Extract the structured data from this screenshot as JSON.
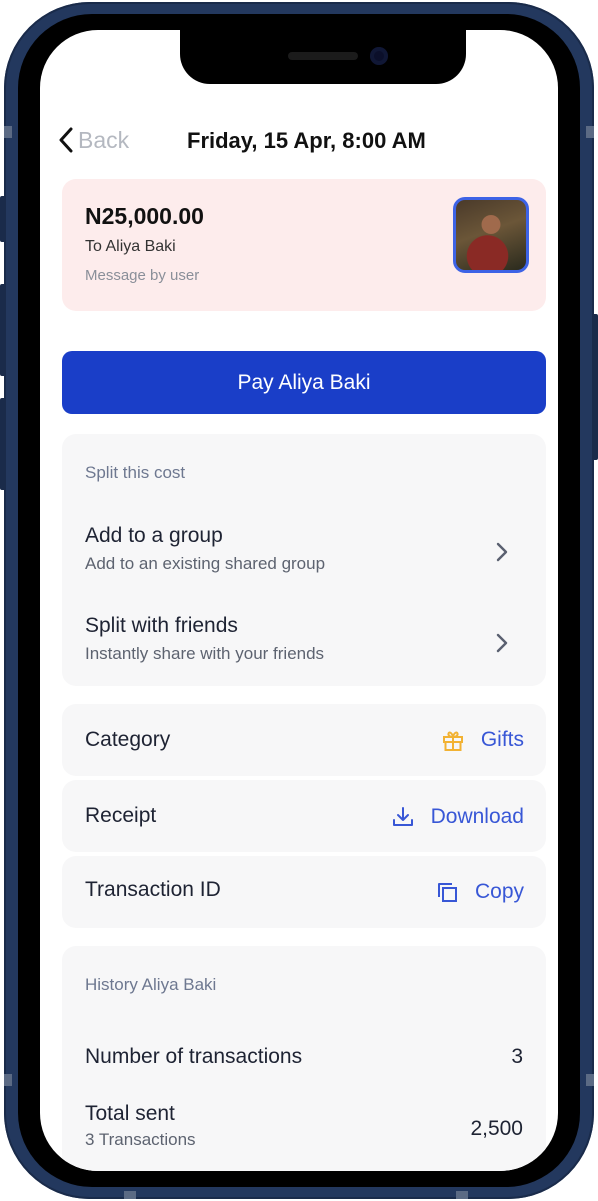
{
  "header": {
    "back_label": "Back",
    "title": "Friday, 15 Apr, 8:00 AM"
  },
  "payment": {
    "amount": "N25,000.00",
    "recipient": "To Aliya Baki",
    "message": "Message by user"
  },
  "pay_button": "Pay Aliya Baki",
  "split": {
    "heading": "Split this cost",
    "items": [
      {
        "title": "Add to a group",
        "subtitle": "Add to an existing shared group"
      },
      {
        "title": "Split with friends",
        "subtitle": "Instantly share with your friends"
      }
    ]
  },
  "details": {
    "category_label": "Category",
    "category_value": "Gifts",
    "receipt_label": "Receipt",
    "receipt_action": "Download",
    "transaction_label": "Transaction ID",
    "transaction_action": "Copy"
  },
  "history": {
    "heading": "History Aliya Baki",
    "count_label": "Number  of transactions",
    "count_value": "3",
    "total_label": "Total sent",
    "total_sub": "3 Transactions",
    "total_value": "2,500"
  },
  "colors": {
    "frame": "#23385e",
    "primary_button": "#1a3ec8",
    "link_blue": "#3857d6",
    "gift_icon": "#f2b233",
    "card_pink": "#fdecec",
    "panel_gray": "#f7f7f8"
  },
  "icons": [
    "chevron-left-icon",
    "chevron-right-icon",
    "gift-icon",
    "download-icon",
    "copy-icon"
  ]
}
